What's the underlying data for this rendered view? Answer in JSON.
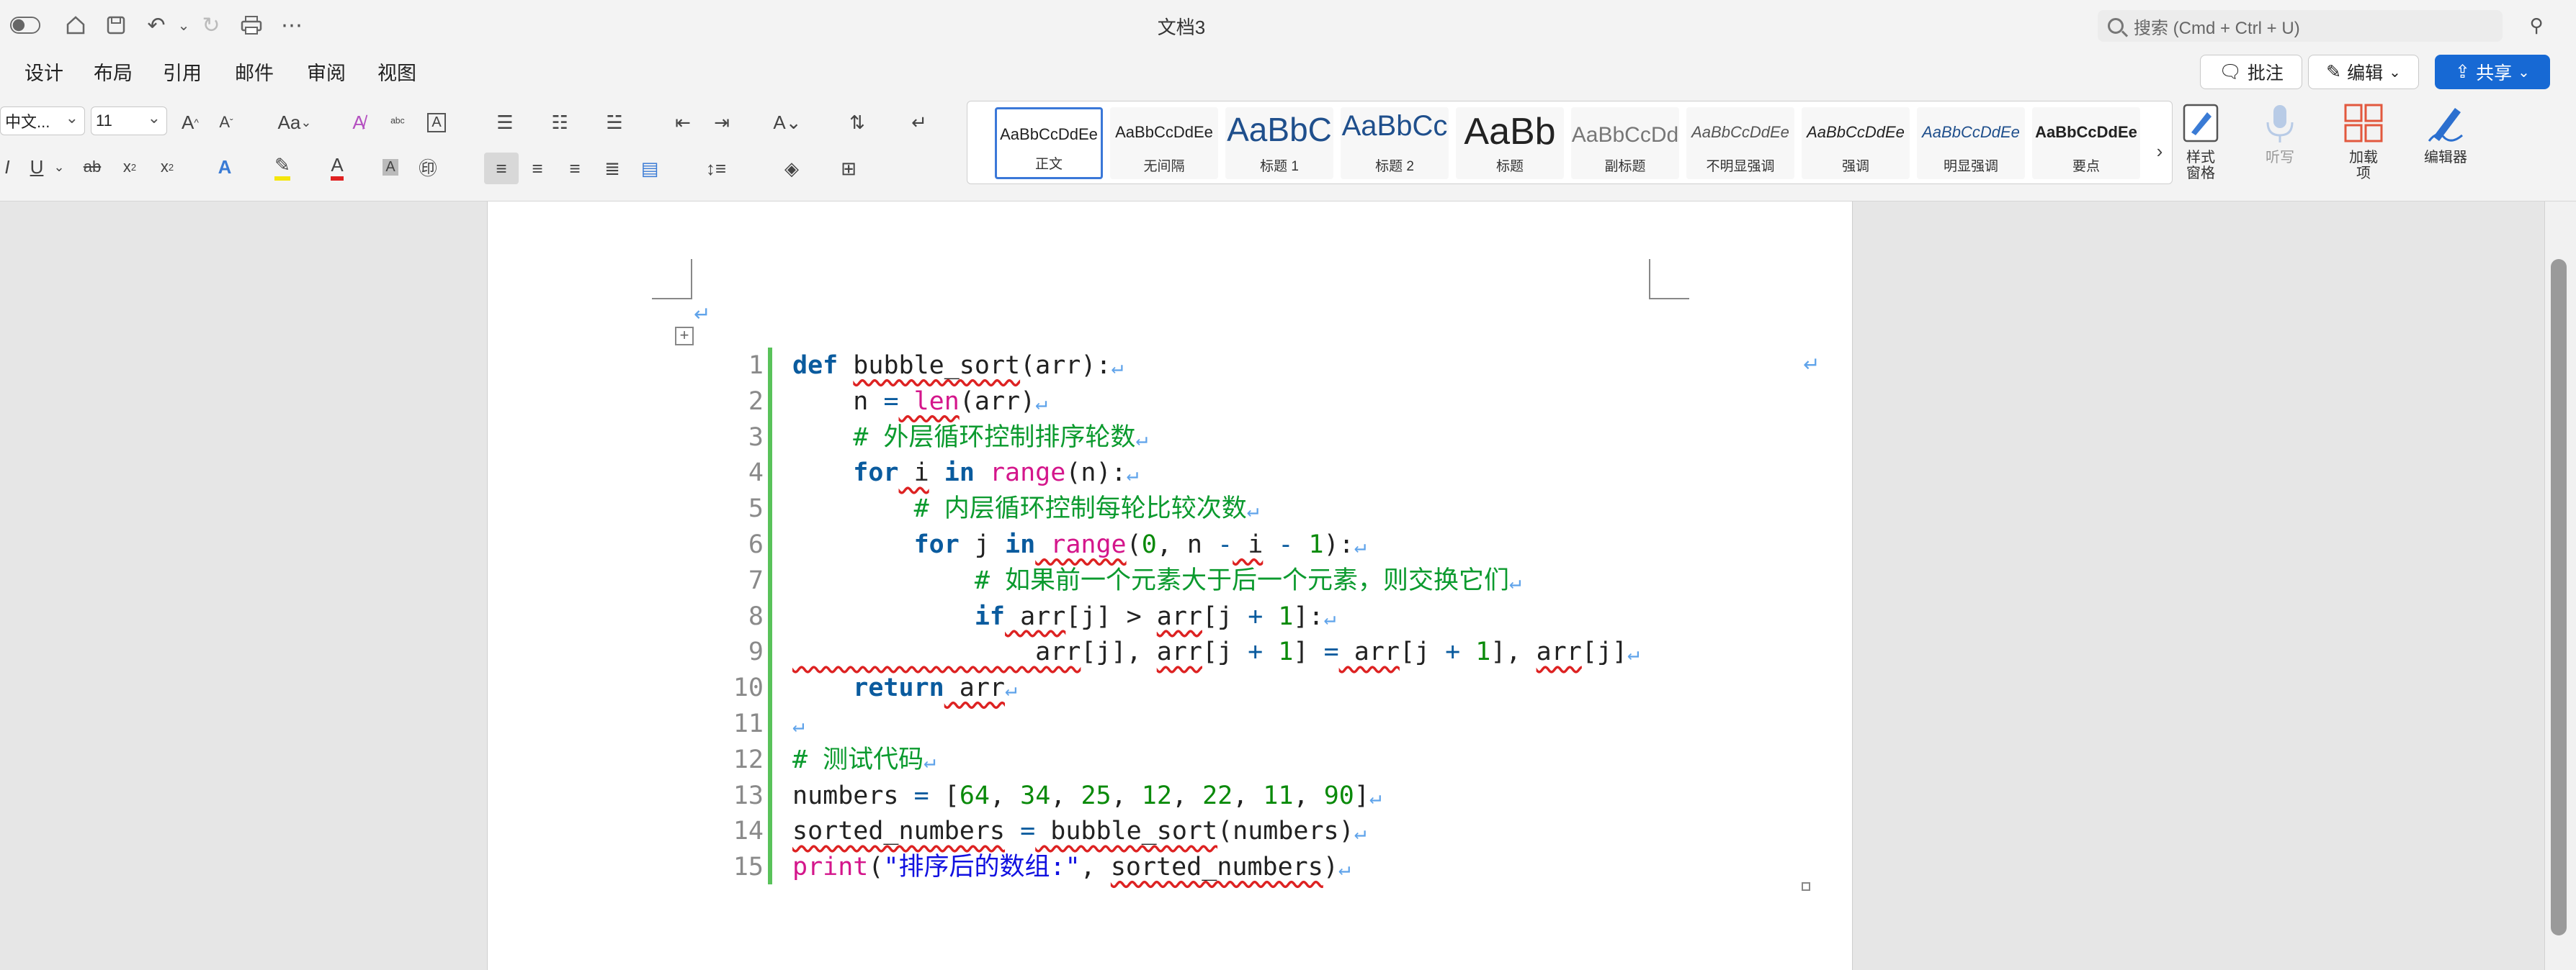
{
  "window": {
    "title": "文档3"
  },
  "search": {
    "placeholder": "搜索 (Cmd + Ctrl + U)"
  },
  "menu": {
    "tabs": [
      "设计",
      "布局",
      "引用",
      "邮件",
      "审阅",
      "视图"
    ]
  },
  "actions": {
    "comment_label": "批注",
    "edit_label": "编辑",
    "share_label": "共享"
  },
  "ribbon": {
    "font_name": "中文...",
    "font_size": "11",
    "case_label": "Aa",
    "styles": [
      {
        "preview": "AaBbCcDdEe",
        "name": "正文",
        "selected": true
      },
      {
        "preview": "AaBbCcDdEe",
        "name": "无间隔"
      },
      {
        "preview": "AaBbC",
        "name": "标题 1"
      },
      {
        "preview": "AaBbCc",
        "name": "标题 2"
      },
      {
        "preview": "AaBb",
        "name": "标题"
      },
      {
        "preview": "AaBbCcDd",
        "name": "副标题"
      },
      {
        "preview": "AaBbCcDdEe",
        "name": "不明显强调"
      },
      {
        "preview": "AaBbCcDdEe",
        "name": "强调"
      },
      {
        "preview": "AaBbCcDdEe",
        "name": "明显强调"
      },
      {
        "preview": "AaBbCcDdEe",
        "name": "要点"
      }
    ],
    "styles_pane_label": "样式\n窗格",
    "dictate_label": "听写",
    "addins_label": "加载\n项",
    "editor_label": "编辑器"
  },
  "code_lines": [
    {
      "n": "1",
      "tokens": [
        [
          "kw",
          "def"
        ],
        [
          "",
          "·"
        ],
        [
          "wav",
          "bubble_sort"
        ],
        [
          "",
          "(arr):"
        ]
      ]
    },
    {
      "n": "2",
      "tokens": [
        [
          "",
          "    n "
        ],
        [
          "op",
          "="
        ],
        [
          "",
          ""
        ],
        [
          "fn wav",
          " len"
        ],
        [
          "",
          "(arr)"
        ]
      ]
    },
    {
      "n": "3",
      "tokens": [
        [
          "cm",
          "    # 外层循环控制排序轮数"
        ]
      ]
    },
    {
      "n": "4",
      "tokens": [
        [
          "kw",
          "    for"
        ],
        [
          "",
          ""
        ],
        [
          "wav",
          " i"
        ],
        [
          "kw",
          " in"
        ],
        [
          "fn",
          " range"
        ],
        [
          "",
          "(n):"
        ]
      ]
    },
    {
      "n": "5",
      "tokens": [
        [
          "cm",
          "        # 内层循环控制每轮比较次数"
        ]
      ]
    },
    {
      "n": "6",
      "tokens": [
        [
          "kw",
          "        for"
        ],
        [
          "",
          " j"
        ],
        [
          "kw",
          " in"
        ],
        [
          "fn wav",
          " range"
        ],
        [
          "",
          "("
        ],
        [
          "num",
          "0"
        ],
        [
          "",
          ", n "
        ],
        [
          "op",
          "-"
        ],
        [
          "wav",
          " i"
        ],
        [
          "op",
          " -"
        ],
        [
          "num",
          " 1"
        ],
        [
          "",
          "):"
        ]
      ]
    },
    {
      "n": "7",
      "tokens": [
        [
          "cm",
          "            # 如果前一个元素大于后一个元素，则交换它们"
        ]
      ]
    },
    {
      "n": "8",
      "tokens": [
        [
          "kw",
          "            if"
        ],
        [
          "wav",
          " arr"
        ],
        [
          "",
          "[j] > "
        ],
        [
          "wav",
          "arr"
        ],
        [
          "",
          "[j "
        ],
        [
          "op",
          "+"
        ],
        [
          "num",
          " 1"
        ],
        [
          "",
          "]:"
        ]
      ]
    },
    {
      "n": "9",
      "tokens": [
        [
          "wav",
          "                arr"
        ],
        [
          "",
          "[j], "
        ],
        [
          "wav",
          "arr"
        ],
        [
          "",
          "[j "
        ],
        [
          "op",
          "+"
        ],
        [
          "num",
          " 1"
        ],
        [
          "",
          "] "
        ],
        [
          "op",
          "="
        ],
        [
          "wav",
          " arr"
        ],
        [
          "",
          "[j "
        ],
        [
          "op",
          "+"
        ],
        [
          "num",
          " 1"
        ],
        [
          "",
          "], "
        ],
        [
          "wav",
          "arr"
        ],
        [
          "",
          "[j]"
        ]
      ]
    },
    {
      "n": "10",
      "tokens": [
        [
          "kw",
          "    return"
        ],
        [
          "wav",
          " arr"
        ]
      ]
    },
    {
      "n": "11",
      "tokens": [
        [
          "",
          ""
        ]
      ]
    },
    {
      "n": "12",
      "tokens": [
        [
          "cm",
          "# 测试代码"
        ]
      ]
    },
    {
      "n": "13",
      "tokens": [
        [
          "",
          "numbers "
        ],
        [
          "op",
          "="
        ],
        [
          "",
          " ["
        ],
        [
          "num",
          "64"
        ],
        [
          "",
          ", "
        ],
        [
          "num",
          "34"
        ],
        [
          "",
          ", "
        ],
        [
          "num",
          "25"
        ],
        [
          "",
          ", "
        ],
        [
          "num",
          "12"
        ],
        [
          "",
          ", "
        ],
        [
          "num",
          "22"
        ],
        [
          "",
          ", "
        ],
        [
          "num",
          "11"
        ],
        [
          "",
          ", "
        ],
        [
          "num",
          "90"
        ],
        [
          "",
          "]"
        ]
      ]
    },
    {
      "n": "14",
      "tokens": [
        [
          "wav",
          "sorted_numbers"
        ],
        [
          "op",
          " ="
        ],
        [
          "wav",
          " bubble_sort"
        ],
        [
          "",
          "(numbers)"
        ]
      ]
    },
    {
      "n": "15",
      "tokens": [
        [
          "fn",
          "print"
        ],
        [
          "",
          "("
        ],
        [
          "str",
          "\"排序后的数组:\""
        ],
        [
          "",
          ", "
        ],
        [
          "wav",
          "sorted_numbers"
        ],
        [
          "",
          ")"
        ]
      ]
    }
  ],
  "colors": {
    "accent": "#1769d4",
    "code_bar": "#59c25a",
    "keyword": "#0a5b9e",
    "builtin": "#d4168b",
    "number": "#0a8a0a",
    "comment": "#0b9a2e",
    "string": "#1010e0"
  }
}
